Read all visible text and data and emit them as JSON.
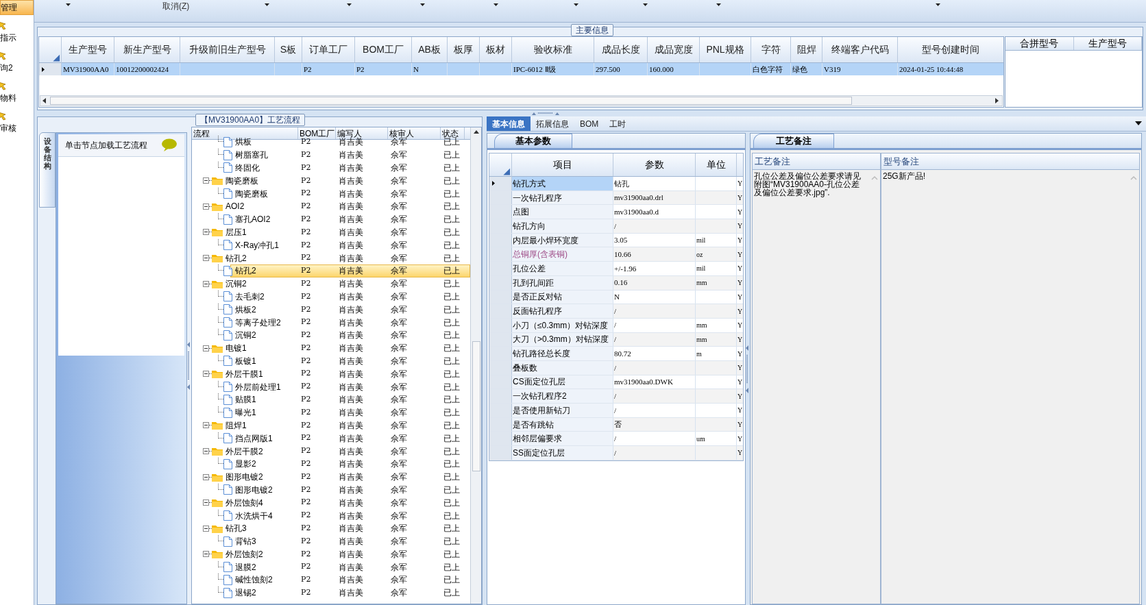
{
  "sidebar": {
    "items": [
      {
        "label": "管理",
        "selected": true
      },
      {
        "label": "指示",
        "selected": false
      },
      {
        "label": "询2",
        "selected": false
      },
      {
        "label": "物料",
        "selected": false
      },
      {
        "label": "审核",
        "selected": false
      }
    ]
  },
  "toolbar": {
    "cancel_label": "取消(Z)"
  },
  "main_info": {
    "title": "主要信息",
    "columns": [
      "生产型号",
      "新生产型号",
      "升级前旧生产型号",
      "S板",
      "订单工厂",
      "BOM工厂",
      "AB板",
      "板厚",
      "板材",
      "验收标准",
      "成品长度",
      "成品宽度",
      "PNL规格",
      "字符",
      "阻焊",
      "终端客户代码",
      "型号创建时间"
    ],
    "rows": [
      {
        "selected": true,
        "cells": [
          "MV31900AA0",
          "10012200002424",
          null,
          null,
          "P2",
          "P2",
          "N",
          null,
          null,
          "IPC-6012 Ⅱ级",
          "297.500",
          "160.000",
          null,
          "白色字符",
          "绿色",
          "V319",
          "2024-01-25 10:44:48"
        ]
      }
    ],
    "side_columns": [
      "合拼型号",
      "生产型号"
    ]
  },
  "process_panel": {
    "title": "【MV31900AA0】工艺流程",
    "side_tab": "设备结构",
    "hint": "单击节点加载工艺流程",
    "columns": [
      "流程",
      "BOM工厂",
      "编写人",
      "核审人",
      "状态"
    ],
    "continued_steps": [
      {
        "name": "烘板",
        "bom": "P2",
        "writer": "肖吉美",
        "reviewer": "佘军",
        "status": "已上",
        "selected": false
      },
      {
        "name": "树脂塞孔",
        "bom": "P2",
        "writer": "肖吉美",
        "reviewer": "佘军",
        "status": "已上",
        "selected": false
      },
      {
        "name": "终固化",
        "bom": "P2",
        "writer": "肖吉美",
        "reviewer": "佘军",
        "status": "已上",
        "selected": false
      }
    ],
    "nodes": [
      {
        "name": "陶瓷磨板",
        "bom": "P2",
        "writer": "肖吉美",
        "reviewer": "佘军",
        "status": "已上",
        "selected": false,
        "expanded": true,
        "children": [
          {
            "name": "陶瓷磨板",
            "bom": "P2",
            "writer": "肖吉美",
            "reviewer": "佘军",
            "status": "已上",
            "selected": false
          }
        ]
      },
      {
        "name": "AOI2",
        "bom": "P2",
        "writer": "肖吉美",
        "reviewer": "佘军",
        "status": "已上",
        "selected": false,
        "expanded": true,
        "children": [
          {
            "name": "塞孔AOI2",
            "bom": "P2",
            "writer": "肖吉美",
            "reviewer": "佘军",
            "status": "已上",
            "selected": false
          }
        ]
      },
      {
        "name": "层压1",
        "bom": "P2",
        "writer": "肖吉美",
        "reviewer": "佘军",
        "status": "已上",
        "selected": false,
        "expanded": true,
        "children": [
          {
            "name": "X-Ray冲孔1",
            "bom": "P2",
            "writer": "肖吉美",
            "reviewer": "佘军",
            "status": "已上",
            "selected": false
          }
        ]
      },
      {
        "name": "钻孔2",
        "bom": "P2",
        "writer": "肖吉美",
        "reviewer": "佘军",
        "status": "已上",
        "selected": false,
        "expanded": true,
        "children": [
          {
            "name": "钻孔2",
            "bom": "P2",
            "writer": "肖吉美",
            "reviewer": "佘军",
            "status": "已上",
            "selected": true
          }
        ]
      },
      {
        "name": "沉铜2",
        "bom": "P2",
        "writer": "肖吉美",
        "reviewer": "佘军",
        "status": "已上",
        "selected": false,
        "expanded": true,
        "children": [
          {
            "name": "去毛刺2",
            "bom": "P2",
            "writer": "肖吉美",
            "reviewer": "佘军",
            "status": "已上",
            "selected": false
          },
          {
            "name": "烘板2",
            "bom": "P2",
            "writer": "肖吉美",
            "reviewer": "佘军",
            "status": "已上",
            "selected": false
          },
          {
            "name": "等离子处理2",
            "bom": "P2",
            "writer": "肖吉美",
            "reviewer": "佘军",
            "status": "已上",
            "selected": false
          },
          {
            "name": "沉铜2",
            "bom": "P2",
            "writer": "肖吉美",
            "reviewer": "佘军",
            "status": "已上",
            "selected": false
          }
        ]
      },
      {
        "name": "电镀1",
        "bom": "P2",
        "writer": "肖吉美",
        "reviewer": "佘军",
        "status": "已上",
        "selected": false,
        "expanded": true,
        "children": [
          {
            "name": "板镀1",
            "bom": "P2",
            "writer": "肖吉美",
            "reviewer": "佘军",
            "status": "已上",
            "selected": false
          }
        ]
      },
      {
        "name": "外层干膜1",
        "bom": "P2",
        "writer": "肖吉美",
        "reviewer": "佘军",
        "status": "已上",
        "selected": false,
        "expanded": true,
        "children": [
          {
            "name": "外层前处理1",
            "bom": "P2",
            "writer": "肖吉美",
            "reviewer": "佘军",
            "status": "已上",
            "selected": false
          },
          {
            "name": "贴膜1",
            "bom": "P2",
            "writer": "肖吉美",
            "reviewer": "佘军",
            "status": "已上",
            "selected": false
          },
          {
            "name": "曝光1",
            "bom": "P2",
            "writer": "肖吉美",
            "reviewer": "佘军",
            "status": "已上",
            "selected": false
          }
        ]
      },
      {
        "name": "阻焊1",
        "bom": "P2",
        "writer": "肖吉美",
        "reviewer": "佘军",
        "status": "已上",
        "selected": false,
        "expanded": true,
        "children": [
          {
            "name": "挡点网版1",
            "bom": "P2",
            "writer": "肖吉美",
            "reviewer": "佘军",
            "status": "已上",
            "selected": false
          }
        ]
      },
      {
        "name": "外层干膜2",
        "bom": "P2",
        "writer": "肖吉美",
        "reviewer": "佘军",
        "status": "已上",
        "selected": false,
        "expanded": true,
        "children": [
          {
            "name": "显影2",
            "bom": "P2",
            "writer": "肖吉美",
            "reviewer": "佘军",
            "status": "已上",
            "selected": false
          }
        ]
      },
      {
        "name": "图形电镀2",
        "bom": "P2",
        "writer": "肖吉美",
        "reviewer": "佘军",
        "status": "已上",
        "selected": false,
        "expanded": true,
        "children": [
          {
            "name": "图形电镀2",
            "bom": "P2",
            "writer": "肖吉美",
            "reviewer": "佘军",
            "status": "已上",
            "selected": false
          }
        ]
      },
      {
        "name": "外层蚀刻4",
        "bom": "P2",
        "writer": "肖吉美",
        "reviewer": "佘军",
        "status": "已上",
        "selected": false,
        "expanded": true,
        "children": [
          {
            "name": "水洗烘干4",
            "bom": "P2",
            "writer": "肖吉美",
            "reviewer": "佘军",
            "status": "已上",
            "selected": false
          }
        ]
      },
      {
        "name": "钻孔3",
        "bom": "P2",
        "writer": "肖吉美",
        "reviewer": "佘军",
        "status": "已上",
        "selected": false,
        "expanded": true,
        "children": [
          {
            "name": "背钻3",
            "bom": "P2",
            "writer": "肖吉美",
            "reviewer": "佘军",
            "status": "已上",
            "selected": false
          }
        ]
      },
      {
        "name": "外层蚀刻2",
        "bom": "P2",
        "writer": "肖吉美",
        "reviewer": "佘军",
        "status": "已上",
        "selected": false,
        "expanded": true,
        "children": [
          {
            "name": "退膜2",
            "bom": "P2",
            "writer": "肖吉美",
            "reviewer": "佘军",
            "status": "已上",
            "selected": false
          },
          {
            "name": "碱性蚀刻2",
            "bom": "P2",
            "writer": "肖吉美",
            "reviewer": "佘军",
            "status": "已上",
            "selected": false
          },
          {
            "name": "退锡2",
            "bom": "P2",
            "writer": "肖吉美",
            "reviewer": "佘军",
            "status": "已上",
            "selected": false
          }
        ]
      }
    ]
  },
  "detail_tabs": [
    {
      "label": "基本信息",
      "selected": true
    },
    {
      "label": "拓展信息",
      "selected": false
    },
    {
      "label": "BOM",
      "selected": false
    },
    {
      "label": "工时",
      "selected": false
    }
  ],
  "basic_params": {
    "tab": "基本参数",
    "columns": [
      "项目",
      "参数",
      "单位"
    ],
    "rows": [
      {
        "item": "钻孔方式",
        "value": "钻孔",
        "unit": null,
        "flag": "Y",
        "selected": true,
        "highlighted": false
      },
      {
        "item": "一次钻孔程序",
        "value": "mv31900aa0.drl",
        "unit": null,
        "flag": "Y",
        "selected": false,
        "highlighted": false
      },
      {
        "item": "点图",
        "value": "mv31900aa0.d",
        "unit": null,
        "flag": "Y",
        "selected": false,
        "highlighted": false
      },
      {
        "item": "钻孔方向",
        "value": "/",
        "unit": null,
        "flag": "Y",
        "selected": false,
        "highlighted": false
      },
      {
        "item": "内层最小焊环宽度",
        "value": "3.05",
        "unit": "mil",
        "flag": "Y",
        "selected": false,
        "highlighted": false
      },
      {
        "item": "总铜厚(含表铜)",
        "value": "10.66",
        "unit": "oz",
        "flag": "Y",
        "selected": false,
        "highlighted": true
      },
      {
        "item": "孔位公差",
        "value": "+/-1.96",
        "unit": "mil",
        "flag": "Y",
        "selected": false,
        "highlighted": false
      },
      {
        "item": "孔到孔间距",
        "value": "0.16",
        "unit": "mm",
        "flag": "Y",
        "selected": false,
        "highlighted": false
      },
      {
        "item": "是否正反对钻",
        "value": "N",
        "unit": null,
        "flag": "Y",
        "selected": false,
        "highlighted": false
      },
      {
        "item": "反面钻孔程序",
        "value": "/",
        "unit": null,
        "flag": "Y",
        "selected": false,
        "highlighted": false
      },
      {
        "item": "小刀（≤0.3mm）对钻深度",
        "value": "/",
        "unit": "mm",
        "flag": "Y",
        "selected": false,
        "highlighted": false
      },
      {
        "item": "大刀（>0.3mm）对钻深度",
        "value": "/",
        "unit": "mm",
        "flag": "Y",
        "selected": false,
        "highlighted": false
      },
      {
        "item": "钻孔路径总长度",
        "value": "80.72",
        "unit": "m",
        "flag": "Y",
        "selected": false,
        "highlighted": false
      },
      {
        "item": "叠板数",
        "value": "/",
        "unit": null,
        "flag": "Y",
        "selected": false,
        "highlighted": false
      },
      {
        "item": "CS面定位孔层",
        "value": "mv31900aa0.DWK",
        "unit": null,
        "flag": "Y",
        "selected": false,
        "highlighted": false
      },
      {
        "item": "一次钻孔程序2",
        "value": "/",
        "unit": null,
        "flag": "Y",
        "selected": false,
        "highlighted": false
      },
      {
        "item": "是否使用新钻刀",
        "value": "/",
        "unit": null,
        "flag": "Y",
        "selected": false,
        "highlighted": false
      },
      {
        "item": "是否有跳钻",
        "value": "否",
        "unit": null,
        "flag": "Y",
        "selected": false,
        "highlighted": false
      },
      {
        "item": "相邻层偏要求",
        "value": "/",
        "unit": "um",
        "flag": "Y",
        "selected": false,
        "highlighted": false
      },
      {
        "item": "SS面定位孔层",
        "value": "/",
        "unit": null,
        "flag": "Y",
        "selected": false,
        "highlighted": false
      }
    ]
  },
  "process_notes": {
    "tab": "工艺备注",
    "columns": [
      {
        "title": "工艺备注",
        "text": "孔位公差及偏位公差要求请见附图“MV31900AA0-孔位公差及偏位公差要求.jpg”."
      },
      {
        "title": "型号备注",
        "text": "25G新产品!"
      }
    ]
  }
}
